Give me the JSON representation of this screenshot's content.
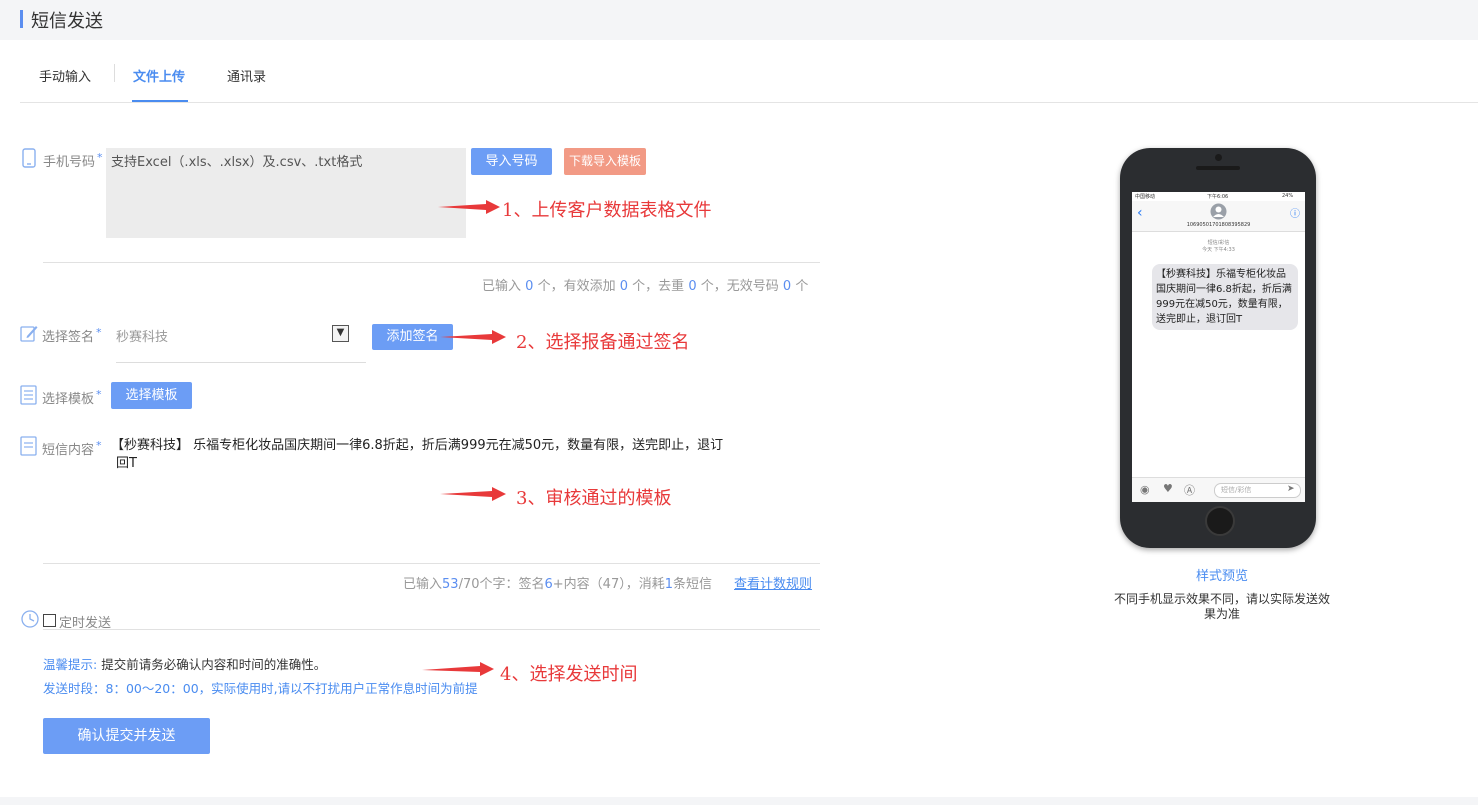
{
  "page": {
    "title": "短信发送"
  },
  "tabs": [
    {
      "label": "手动输入"
    },
    {
      "label": "文件上传"
    },
    {
      "label": "通讯录"
    }
  ],
  "phone_field": {
    "label": "手机号码",
    "required": "*",
    "placeholder": "支持Excel（.xls、.xlsx）及.csv、.txt格式",
    "import_button": "导入号码",
    "template_button": "下载导入模板"
  },
  "import_stats": {
    "entered_label": "已输入",
    "entered": "0",
    "unit1": "个，有效添加",
    "valid": "0",
    "unit2": "个，去重",
    "dedup": "0",
    "unit3": "个，无效号码",
    "invalid": "0",
    "unit4": "个"
  },
  "signature": {
    "label": "选择签名",
    "required": "*",
    "selected": "秒赛科技",
    "add_button": "添加签名"
  },
  "template": {
    "label": "选择模板",
    "required": "*",
    "button": "选择模板"
  },
  "content": {
    "label": "短信内容",
    "required": "*",
    "text_line1": "【秒赛科技】 乐福专柜化妆品国庆期间一律6.8折起，折后满999元在减50元，数量有限，送完即止，退订",
    "text_line2": "回T"
  },
  "count_stats": {
    "prefix": "已输入",
    "count": "53",
    "suffix": "/70个字：签名",
    "sig_count": "6",
    "content_part": "+内容（47），消耗",
    "sms_count": "1",
    "sms_suffix": "条短信",
    "rule_link": "查看计数规则"
  },
  "schedule": {
    "label": "定时发送"
  },
  "tips": {
    "title": "温馨提示:",
    "line1": "提交前请务必确认内容和时间的准确性。",
    "line2": "发送时段：8：00～20：00，实际使用时,请以不打扰用户正常作息时间为前提"
  },
  "submit": {
    "label": "确认提交并发送"
  },
  "annotations": [
    "1、上传客户数据表格文件",
    "2、选择报备通过签名",
    "3、审核通过的模板",
    "4、选择发送时间"
  ],
  "preview": {
    "status_left": "中国移动",
    "status_time": "下午6:06",
    "status_battery": "24%",
    "sender": "1069050170180839​5829",
    "msg_type": "短信/彩信",
    "msg_time": "今天 下午4:33",
    "message": "【秒赛科技】乐福专柜化妆品国庆期间一律6.8折起，折后满999元在减50元，数量有限，送完即止，退订回T",
    "input_placeholder": "短信/彩信",
    "title": "样式预览",
    "note": "不同手机显示效果不同，请以实际发送效果为准"
  },
  "colors": {
    "accent": "#5b8ef0",
    "button": "#6c9df5",
    "orange": "#f29a85",
    "annotation": "#e8393a"
  }
}
